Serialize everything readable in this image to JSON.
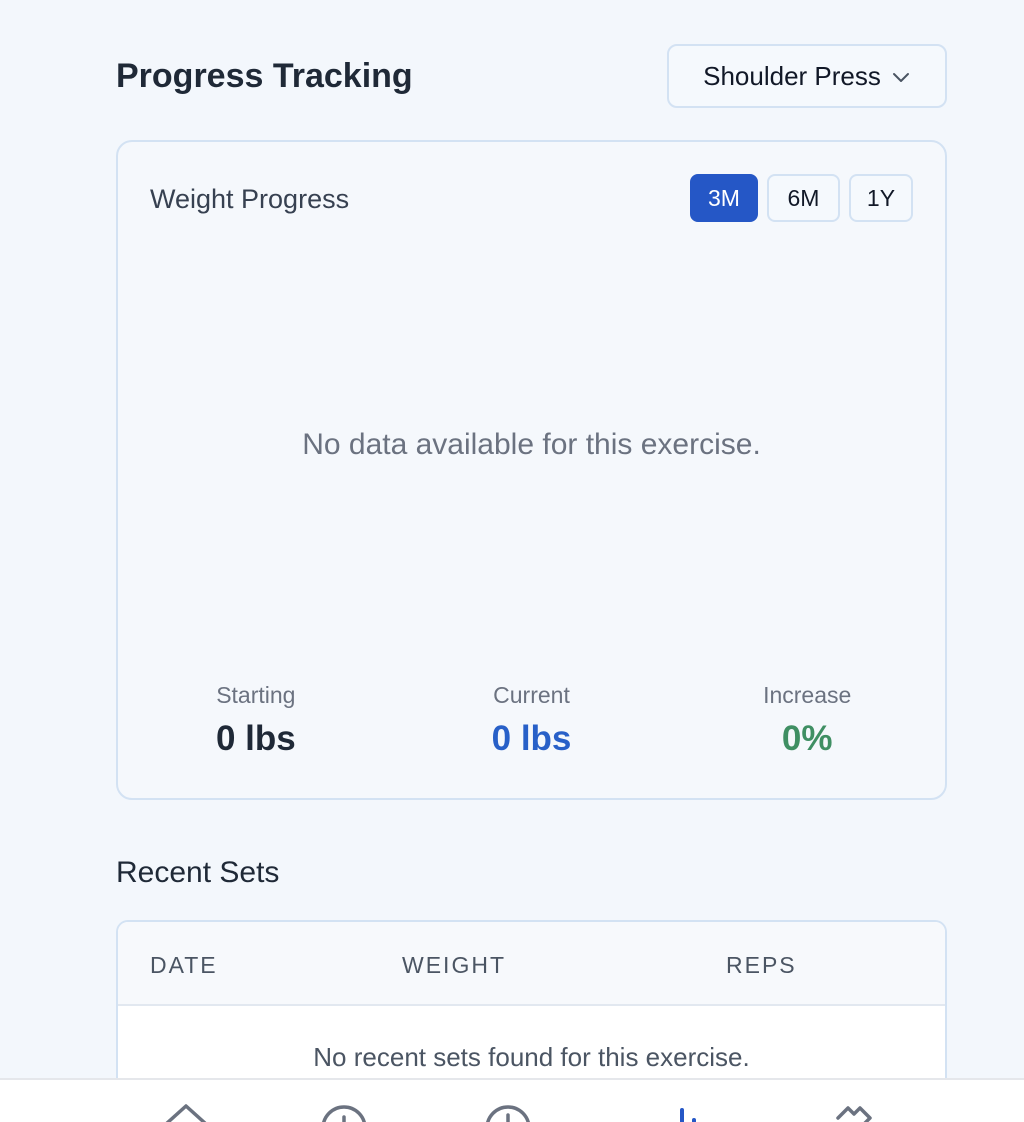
{
  "header": {
    "title": "Progress Tracking",
    "exercise_selected": "Shoulder Press"
  },
  "progress_card": {
    "title": "Weight Progress",
    "ranges": [
      "3M",
      "6M",
      "1Y"
    ],
    "active_range": "3M",
    "empty_message": "No data available for this exercise.",
    "stats": {
      "starting": {
        "label": "Starting",
        "value": "0 lbs"
      },
      "current": {
        "label": "Current",
        "value": "0 lbs"
      },
      "increase": {
        "label": "Increase",
        "value": "0%"
      }
    }
  },
  "recent_sets": {
    "title": "Recent Sets",
    "columns": [
      "DATE",
      "WEIGHT",
      "REPS"
    ],
    "empty_message": "No recent sets found for this exercise."
  },
  "bottom_nav": {
    "items": [
      {
        "icon": "home-icon"
      },
      {
        "icon": "add-icon"
      },
      {
        "icon": "history-icon"
      },
      {
        "icon": "chart-icon",
        "active": true
      },
      {
        "icon": "tools-icon"
      }
    ]
  },
  "colors": {
    "accent": "#2557c6",
    "current_value": "#2860c8",
    "increase_value": "#3f8f63",
    "background": "#f3f7fc"
  }
}
